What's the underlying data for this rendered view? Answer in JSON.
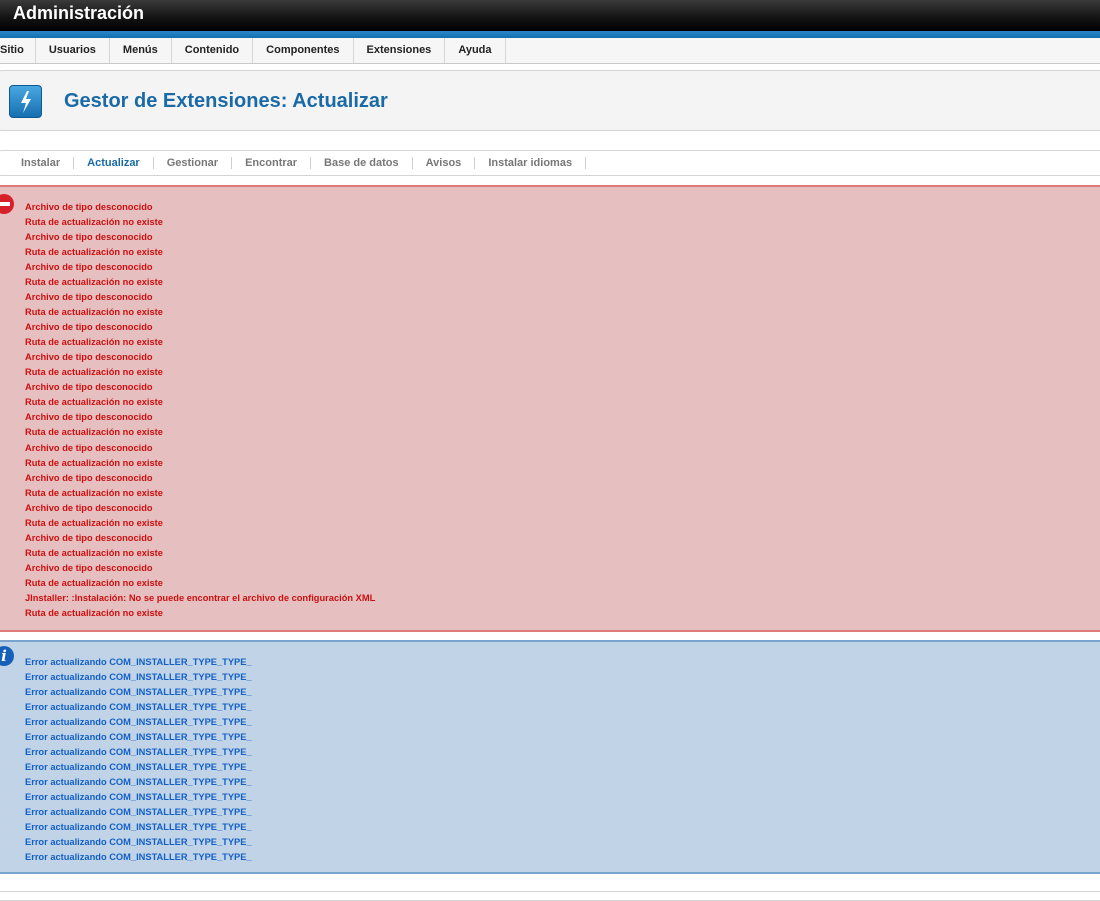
{
  "header": {
    "title": "Administración"
  },
  "menu": [
    {
      "label": "Sitio"
    },
    {
      "label": "Usuarios"
    },
    {
      "label": "Menús"
    },
    {
      "label": "Contenido"
    },
    {
      "label": "Componentes"
    },
    {
      "label": "Extensiones"
    },
    {
      "label": "Ayuda"
    }
  ],
  "page": {
    "title": "Gestor de Extensiones: Actualizar",
    "icon": "extensions-lightning-icon"
  },
  "subnav": {
    "active": "Actualizar",
    "items": [
      {
        "label": "Instalar"
      },
      {
        "label": "Actualizar"
      },
      {
        "label": "Gestionar"
      },
      {
        "label": "Encontrar"
      },
      {
        "label": "Base de datos"
      },
      {
        "label": "Avisos"
      },
      {
        "label": "Instalar idiomas"
      }
    ]
  },
  "error_messages": [
    "Archivo de tipo desconocido",
    "Ruta de actualización no existe",
    "Archivo de tipo desconocido",
    "Ruta de actualización no existe",
    "Archivo de tipo desconocido",
    "Ruta de actualización no existe",
    "Archivo de tipo desconocido",
    "Ruta de actualización no existe",
    "Archivo de tipo desconocido",
    "Ruta de actualización no existe",
    "Archivo de tipo desconocido",
    "Ruta de actualización no existe",
    "Archivo de tipo desconocido",
    "Ruta de actualización no existe",
    "Archivo de tipo desconocido",
    "Ruta de actualización no existe",
    "Archivo de tipo desconocido",
    "Ruta de actualización no existe",
    "Archivo de tipo desconocido",
    "Ruta de actualización no existe",
    "Archivo de tipo desconocido",
    "Ruta de actualización no existe",
    "Archivo de tipo desconocido",
    "Ruta de actualización no existe",
    "Archivo de tipo desconocido",
    "Ruta de actualización no existe",
    "JInstaller: :Instalación: No se puede encontrar el archivo de configuración XML",
    "Ruta de actualización no existe"
  ],
  "info_messages": [
    "Error actualizando COM_INSTALLER_TYPE_TYPE_",
    "Error actualizando COM_INSTALLER_TYPE_TYPE_",
    "Error actualizando COM_INSTALLER_TYPE_TYPE_",
    "Error actualizando COM_INSTALLER_TYPE_TYPE_",
    "Error actualizando COM_INSTALLER_TYPE_TYPE_",
    "Error actualizando COM_INSTALLER_TYPE_TYPE_",
    "Error actualizando COM_INSTALLER_TYPE_TYPE_",
    "Error actualizando COM_INSTALLER_TYPE_TYPE_",
    "Error actualizando COM_INSTALLER_TYPE_TYPE_",
    "Error actualizando COM_INSTALLER_TYPE_TYPE_",
    "Error actualizando COM_INSTALLER_TYPE_TYPE_",
    "Error actualizando COM_INSTALLER_TYPE_TYPE_",
    "Error actualizando COM_INSTALLER_TYPE_TYPE_",
    "Error actualizando COM_INSTALLER_TYPE_TYPE_"
  ],
  "colors": {
    "header_bg": "#111111",
    "accent_stripe": "#1f7ec0",
    "page_title": "#1a6aa7",
    "error_bg": "#e6bfc0",
    "error_text": "#cc1010",
    "info_bg": "#c1d3e6",
    "info_text": "#1160c8"
  },
  "icons": {
    "error": "error-minus-icon",
    "info": "info-icon"
  }
}
